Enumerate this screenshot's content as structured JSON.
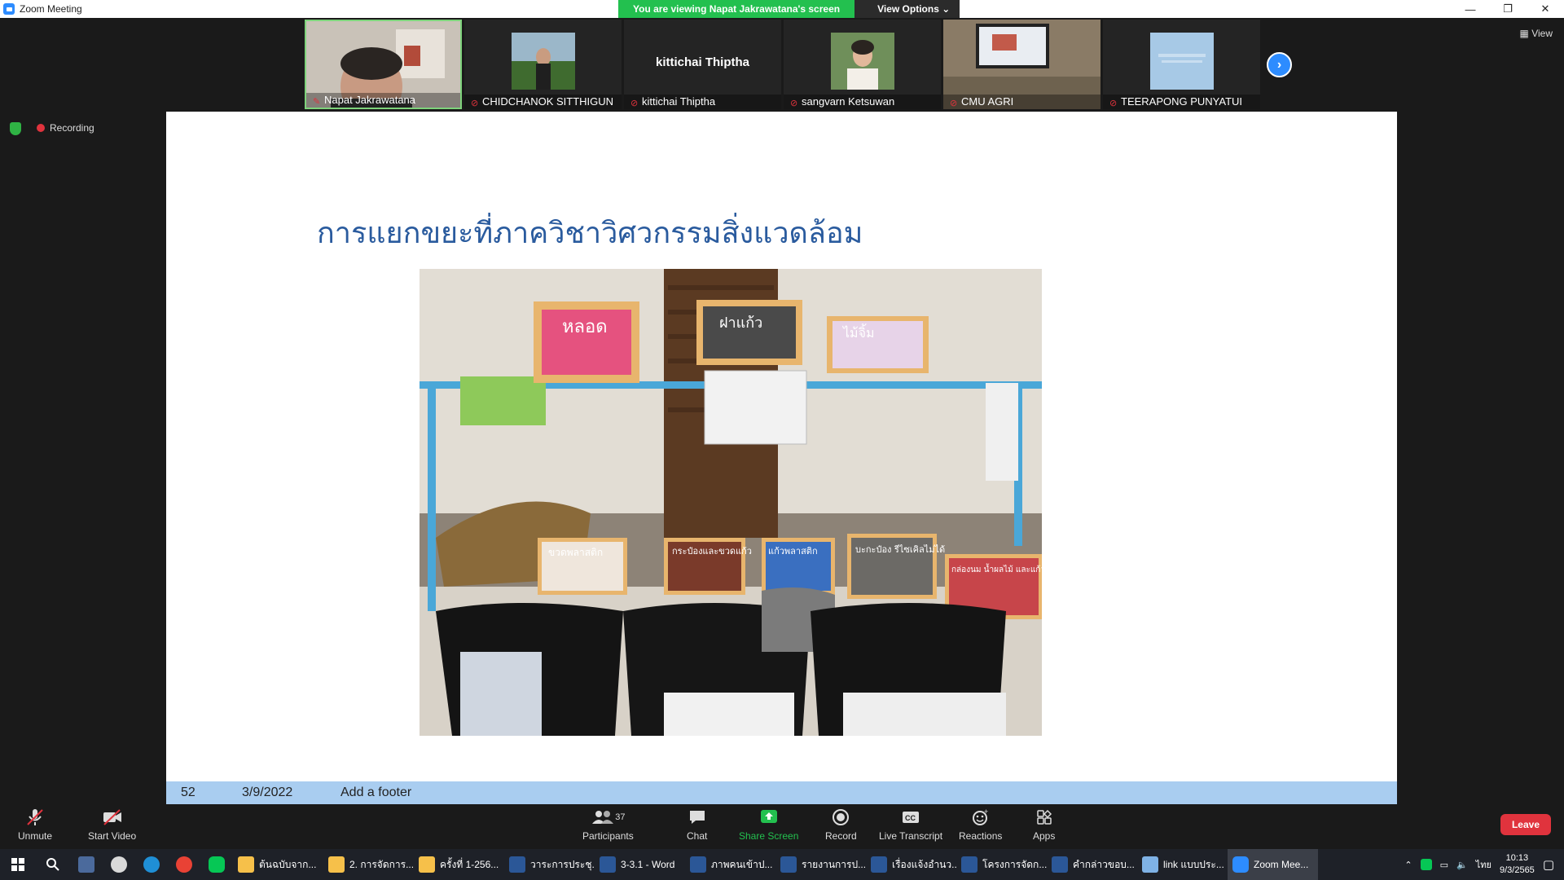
{
  "window": {
    "title": "Zoom Meeting"
  },
  "banner": {
    "viewing": "You are viewing Napat Jakrawatana's screen",
    "view_options": "View Options ⌄"
  },
  "window_controls": {
    "minimize": "—",
    "maximize": "❐",
    "close": "✕"
  },
  "gallery": {
    "participants": [
      {
        "name": "Napat Jakrawatana",
        "kind": "video"
      },
      {
        "name": "CHIDCHANOK SITTHIGUN",
        "kind": "photo"
      },
      {
        "name": "kittichai Thiptha",
        "kind": "name"
      },
      {
        "name": "sangvarn  Ketsuwan",
        "kind": "photo"
      },
      {
        "name": "CMU AGRI",
        "kind": "video"
      },
      {
        "name": "TEERAPONG PUNYATUI",
        "kind": "photo"
      }
    ],
    "big_name": "kittichai Thiptha",
    "next_icon": "›",
    "view_label": "View"
  },
  "status": {
    "recording": "Recording"
  },
  "slide": {
    "heading": "การแยกขยะที่ภาควิชาวิศวกรรมสิ่งแวดล้อม",
    "photo_labels": [
      "หลอด",
      "ฝาแก้ว",
      "ไม้จิ้ม",
      "ขวดพลาสติก",
      "กระป๋องและขวดแก้ว",
      "แก้วพลาสติก",
      "บะกะป๋อง รีไซเคิลไม่ได้",
      "กล่องนม น้ำผลไม้ และแก้วกระดาษ"
    ],
    "slide_number": "52",
    "date": "3/9/2022",
    "footer": "Add a footer"
  },
  "toolbar": {
    "unmute": "Unmute",
    "start_video": "Start Video",
    "participants": "Participants",
    "participants_count": "37",
    "chat": "Chat",
    "share_screen": "Share Screen",
    "record": "Record",
    "live_transcript": "Live Transcript",
    "reactions": "Reactions",
    "apps": "Apps",
    "leave": "Leave"
  },
  "taskbar": {
    "items": [
      {
        "label": "ต้นฉบับจาก...",
        "color": "#f6c04a"
      },
      {
        "label": "2. การจัดการ...",
        "color": "#f6c04a"
      },
      {
        "label": "ครั้งที่ 1-256...",
        "color": "#f6c04a"
      },
      {
        "label": "วาระการประชุ...",
        "color": "#2b5797"
      },
      {
        "label": "3-3.1 - Word",
        "color": "#2b5797"
      },
      {
        "label": "ภาพคนเข้าป...",
        "color": "#2b5797"
      },
      {
        "label": "รายงานการป...",
        "color": "#2b5797"
      },
      {
        "label": "เรื่องแจ้งอำนว...",
        "color": "#2b5797"
      },
      {
        "label": "โครงการจัดก...",
        "color": "#2b5797"
      },
      {
        "label": "คำกล่าวขอบ...",
        "color": "#2b5797"
      },
      {
        "label": "link แบบประ...",
        "color": "#7fb2e5"
      },
      {
        "label": "Zoom Mee...",
        "color": "#2d8cff"
      }
    ],
    "lang": "ไทย",
    "time": "10:13",
    "date": "9/3/2565"
  },
  "colors": {
    "accent": "#2d8cff",
    "green": "#23c04f",
    "leave": "#e0333d",
    "heading": "#2a5b9e"
  }
}
